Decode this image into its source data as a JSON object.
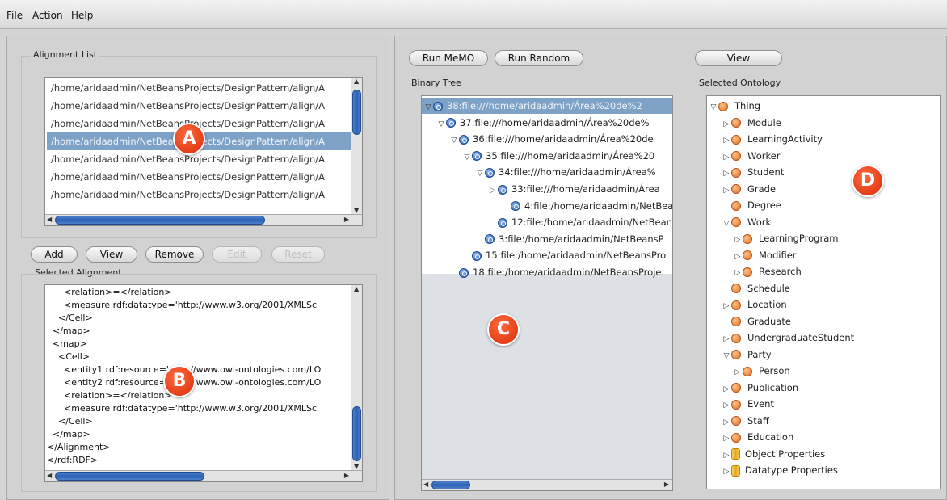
{
  "menubar": {
    "items": [
      "File",
      "Action",
      "Help"
    ]
  },
  "alignment_list": {
    "label": "Alignment List",
    "items": [
      "/home/aridaadmin/NetBeansProjects/DesignPattern/align/A",
      "/home/aridaadmin/NetBeansProjects/DesignPattern/align/A",
      "/home/aridaadmin/NetBeansProjects/DesignPattern/align/A",
      "/home/aridaadmin/NetBeansProjects/DesignPattern/align/A",
      "/home/aridaadmin/NetBeansProjects/DesignPattern/align/A",
      "/home/aridaadmin/NetBeansProjects/DesignPattern/align/A",
      "/home/aridaadmin/NetBeansProjects/DesignPattern/align/A"
    ],
    "selected_index": 3
  },
  "alignment_buttons": {
    "add": "Add",
    "view": "View",
    "remove": "Remove",
    "edit": "Edit",
    "reset": "Reset"
  },
  "selected_alignment": {
    "label": "Selected Alignment",
    "lines": [
      "      <relation>=</relation>",
      "      <measure rdf:datatype='http://www.w3.org/2001/XMLSc",
      "    </Cell>",
      "  </map>",
      "  <map>",
      "    <Cell>",
      "      <entity1 rdf:resource='http://www.owl-ontologies.com/LO",
      "      <entity2 rdf:resource='http://www.owl-ontologies.com/LO",
      "      <relation>=</relation>",
      "      <measure rdf:datatype='http://www.w3.org/2001/XMLSc",
      "    </Cell>",
      "  </map>",
      "</Alignment>",
      "</rdf:RDF>"
    ]
  },
  "toolbar": {
    "run_memo": "Run MeMO",
    "run_random": "Run Random",
    "view": "View"
  },
  "binary_tree": {
    "label": "Binary Tree",
    "nodes": [
      "38:file:///home/aridaadmin/Área%20de%2",
      "37:file:///home/aridaadmin/Área%20de%",
      "36:file:///home/aridaadmin/Área%20de",
      "35:file:///home/aridaadmin/Área%20",
      "34:file:///home/aridaadmin/Área%",
      "33:file:///home/aridaadmin/Área",
      "4:file:/home/aridaadmin/NetBea",
      "12:file:/home/aridaadmin/NetBean",
      "3:file:/home/aridaadmin/NetBeansP",
      "15:file:/home/aridaadmin/NetBeansPro",
      "18:file:/home/aridaadmin/NetBeansProje"
    ]
  },
  "selected_ontology": {
    "label": "Selected Ontology",
    "nodes": [
      "Thing",
      "Module",
      "LearningActivity",
      "Worker",
      "Student",
      "Grade",
      "Degree",
      "Work",
      "LearningProgram",
      "Modifier",
      "Research",
      "Schedule",
      "Location",
      "Graduate",
      "UndergraduateStudent",
      "Party",
      "Person",
      "Publication",
      "Event",
      "Staff",
      "Education",
      "Object Properties",
      "Datatype Properties"
    ]
  },
  "callouts": {
    "a": "A",
    "b": "B",
    "c": "C",
    "d": "D"
  },
  "colors": {
    "selection": "#7ea1c6",
    "scroll_thumb": "#2d62b5",
    "callout": "#e2360f",
    "node_blue": "#2a5fb0",
    "node_orange": "#e0701e"
  }
}
